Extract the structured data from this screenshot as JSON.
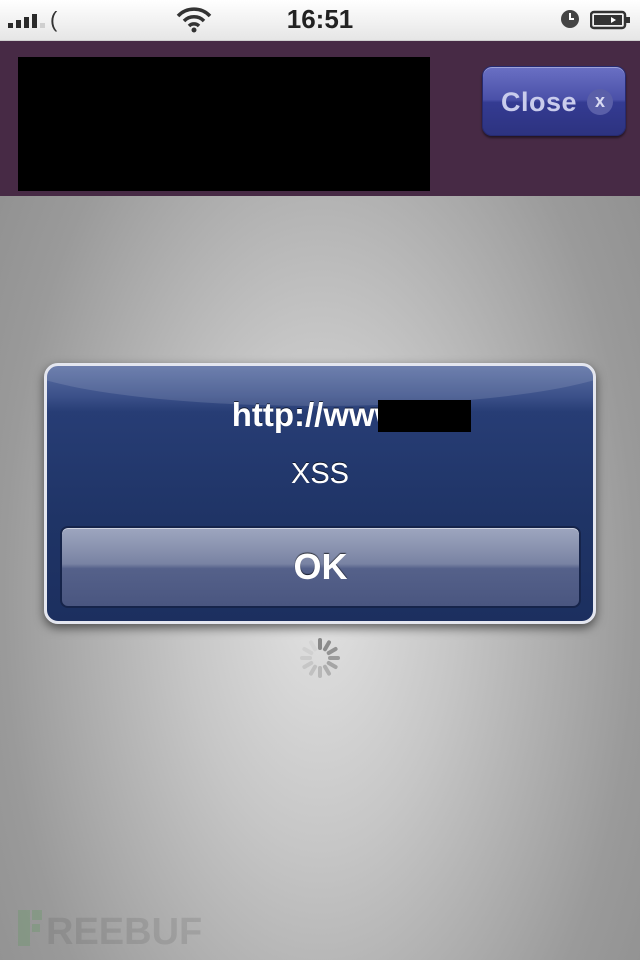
{
  "status_bar": {
    "carrier": "(",
    "time": "16:51",
    "signal_bars": 4,
    "icons": [
      "signal-icon",
      "wifi-icon",
      "alarm-clock-icon",
      "battery-charging-icon"
    ]
  },
  "banner": {
    "close_label": "Close",
    "close_x": "x",
    "background_color": "#472a45",
    "button_color": "#343b92"
  },
  "alert": {
    "title": "http://www.",
    "message": "XSS",
    "ok_label": "OK",
    "background_color": "#1f3466"
  },
  "watermark": {
    "text": "FREEBUF"
  }
}
